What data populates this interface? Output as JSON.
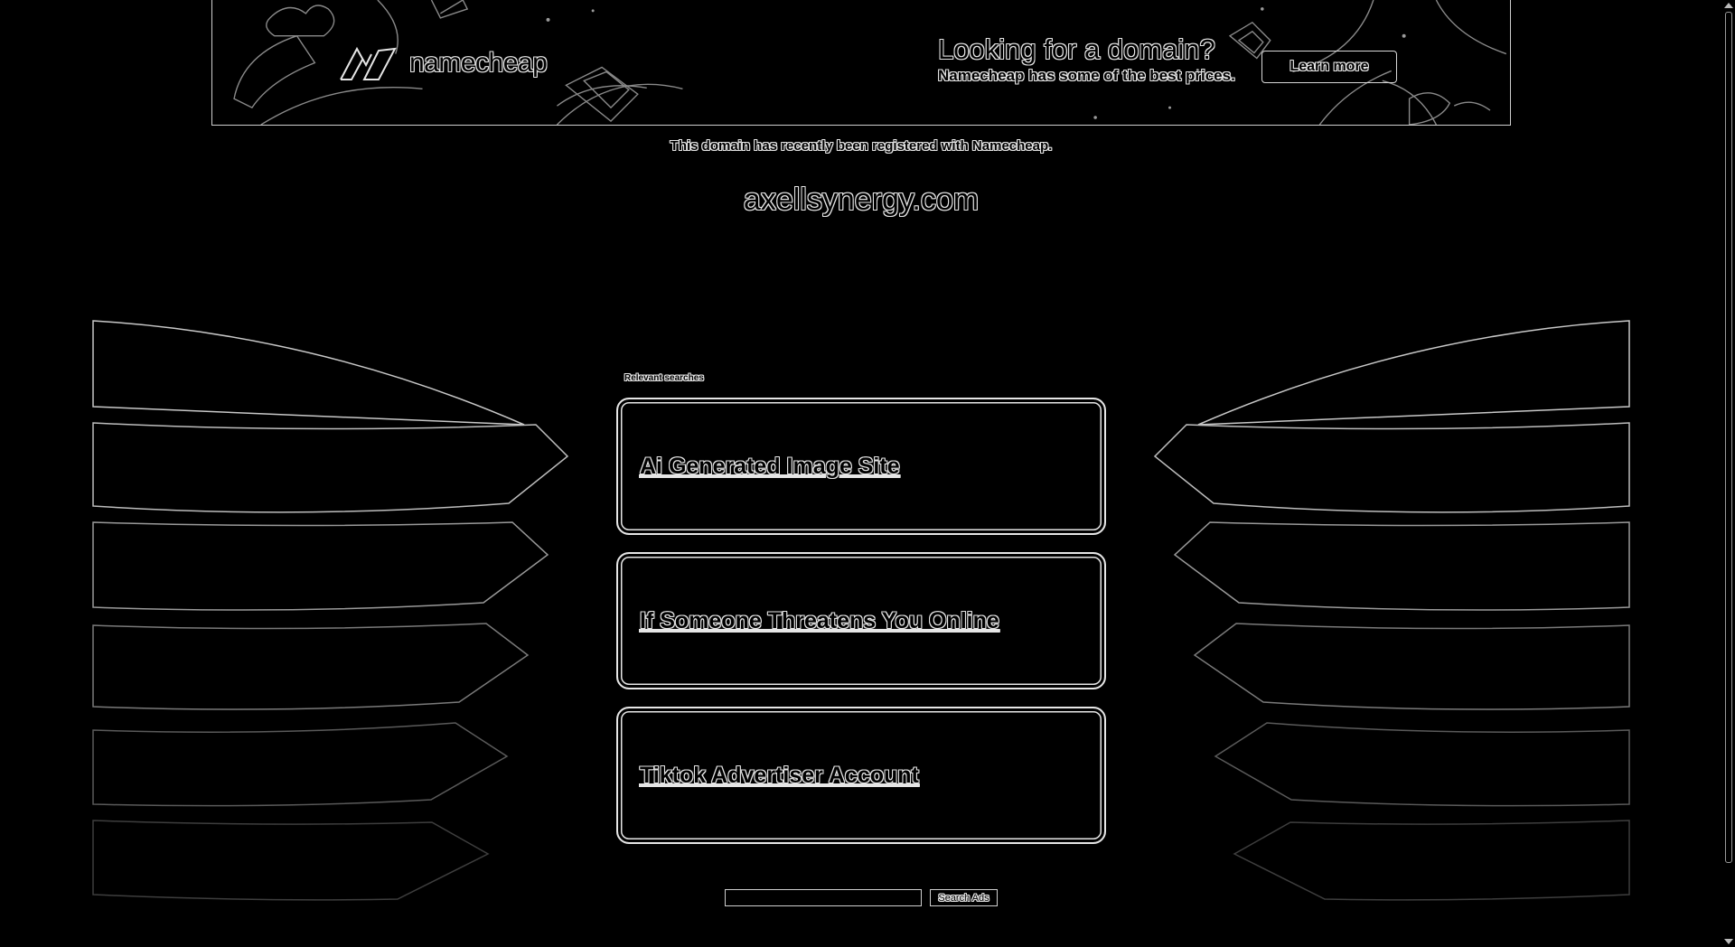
{
  "banner": {
    "brand_name": "namecheap",
    "promo_title": "Looking for a domain?",
    "promo_subtitle": "Namecheap has some of the best prices.",
    "cta_label": "Learn more"
  },
  "notice": "This domain has recently been registered with Namecheap.",
  "domain": "axellsynergy.com",
  "related": {
    "label": "Relevant searches",
    "links": [
      {
        "label": "Ai Generated Image Site"
      },
      {
        "label": "If Someone Threatens You Online"
      },
      {
        "label": "Tiktok Advertiser Account"
      }
    ]
  },
  "search": {
    "value": "",
    "button_label": "Search Ads"
  },
  "colors": {
    "background": "#000000",
    "outline": "#e6e6e6"
  }
}
